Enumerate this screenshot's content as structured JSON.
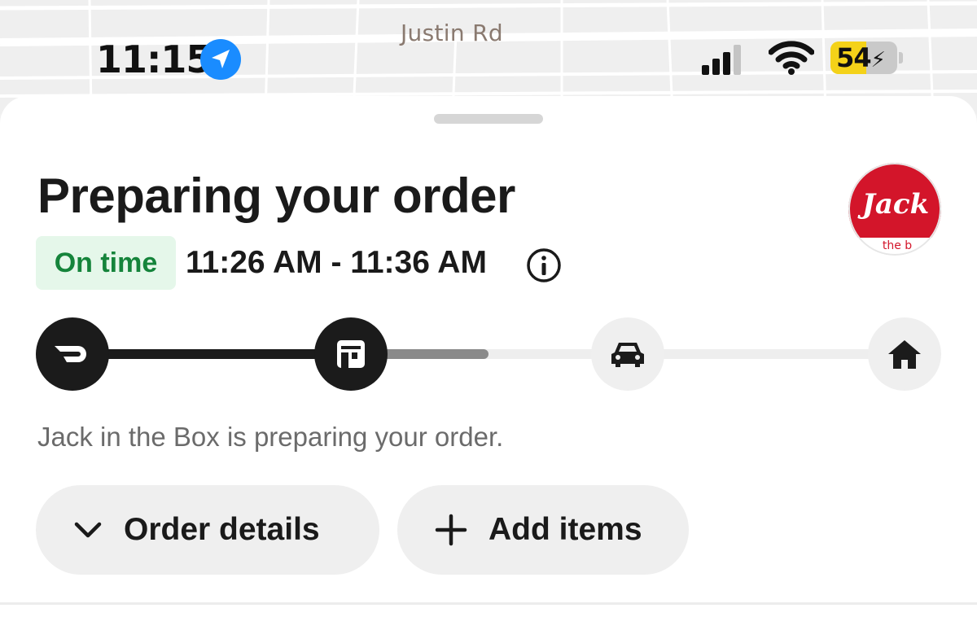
{
  "map": {
    "street_label": "Justin Rd"
  },
  "status_bar": {
    "time": "11:15",
    "battery": "54",
    "battery_level": 0.54
  },
  "order": {
    "title": "Preparing your order",
    "badge": "On time",
    "eta": "11:26 AM - 11:36 AM",
    "status_message": "Jack in the Box is preparing your order.",
    "progress_steps": [
      {
        "icon": "doordash-icon",
        "state": "complete"
      },
      {
        "icon": "store-icon",
        "state": "active"
      },
      {
        "icon": "car-icon",
        "state": "pending"
      },
      {
        "icon": "home-icon",
        "state": "pending"
      }
    ]
  },
  "restaurant": {
    "logo_text": "Jack",
    "logo_subtext": "the b"
  },
  "actions": {
    "order_details": "Order details",
    "add_items": "Add items"
  },
  "colors": {
    "ontime_bg": "#e5f7ea",
    "ontime_text": "#15843b",
    "progress_active": "#1b1b1b",
    "logo_red": "#d3152a",
    "location_blue": "#1a8cff",
    "battery_yellow": "#f4d219"
  }
}
